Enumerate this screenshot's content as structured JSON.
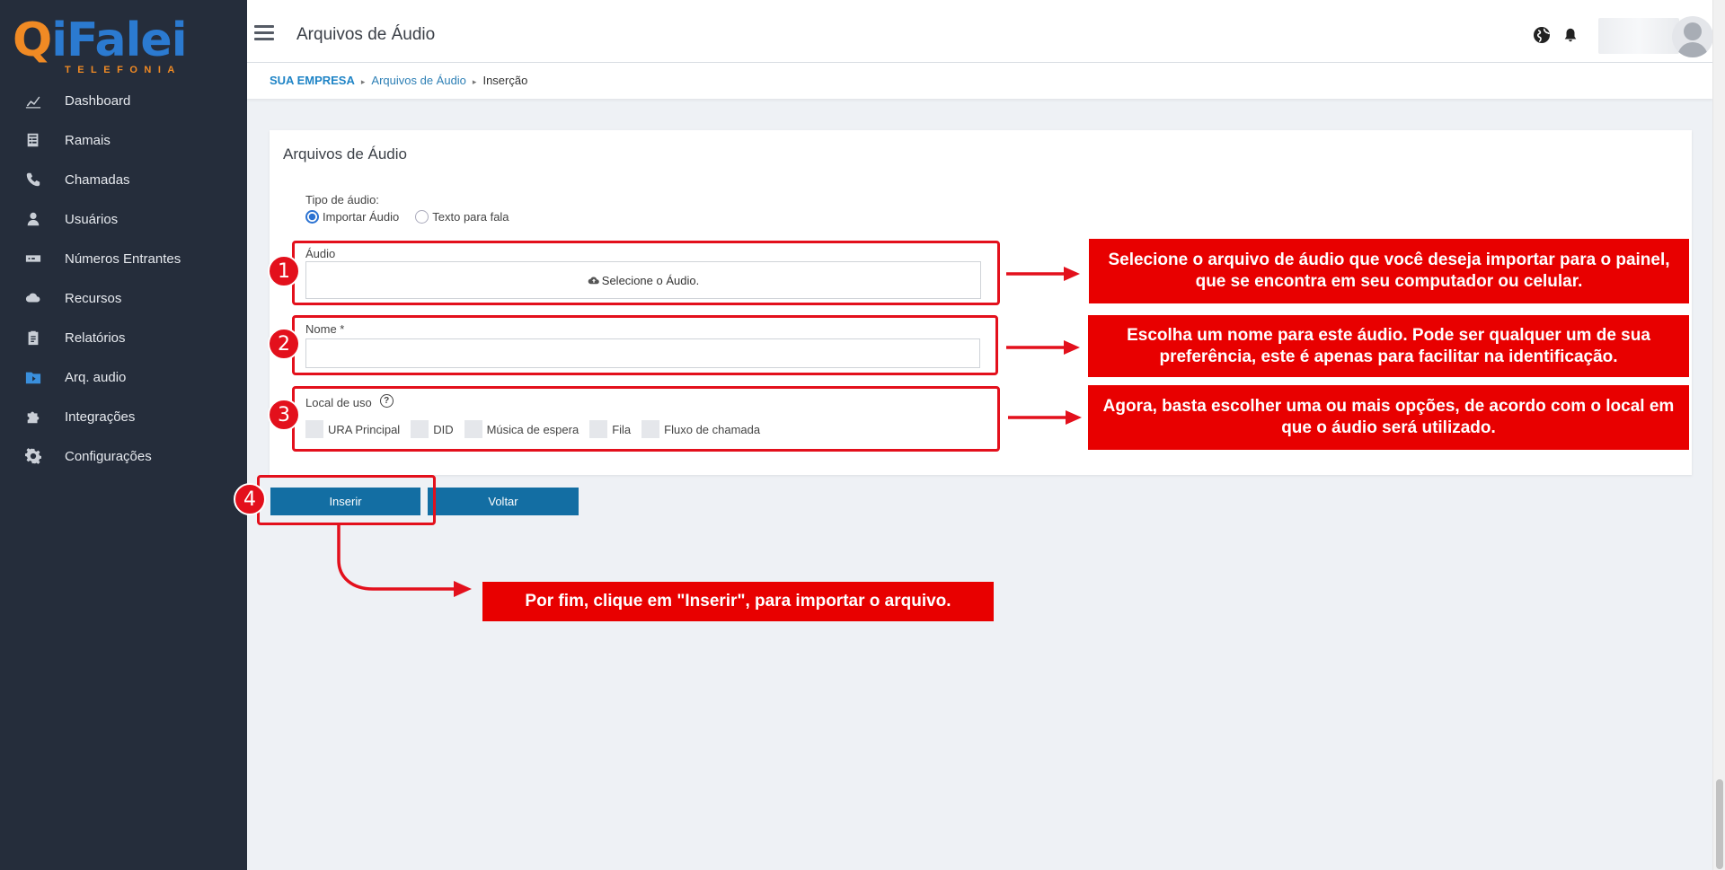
{
  "brand": {
    "logo_main": "iFalei",
    "logo_sub": "TELEFONIA",
    "orange": "#f08a24",
    "blue": "#2b7ad0"
  },
  "sidebar": {
    "items": [
      {
        "label": "Dashboard",
        "icon": "chart-icon"
      },
      {
        "label": "Ramais",
        "icon": "phonebook-icon"
      },
      {
        "label": "Chamadas",
        "icon": "phone-icon"
      },
      {
        "label": "Usuários",
        "icon": "user-icon"
      },
      {
        "label": "Números Entrantes",
        "icon": "did-icon"
      },
      {
        "label": "Recursos",
        "icon": "cloud-icon"
      },
      {
        "label": "Relatórios",
        "icon": "clipboard-icon"
      },
      {
        "label": "Arq. audio",
        "icon": "audio-folder-icon"
      },
      {
        "label": "Integrações",
        "icon": "puzzle-icon"
      },
      {
        "label": "Configurações",
        "icon": "gear-icon"
      }
    ]
  },
  "header": {
    "title": "Arquivos de Áudio"
  },
  "breadcrumb": {
    "company": "SUA EMPRESA",
    "section": "Arquivos de Áudio",
    "current": "Inserção"
  },
  "form": {
    "card_title": "Arquivos de Áudio",
    "tipo_label": "Tipo de áudio:",
    "radio_import": "Importar Áudio",
    "radio_tts": "Texto para fala",
    "selected_type": "Importar Áudio",
    "audio_label": "Áudio",
    "upload_text": "Selecione o Áudio.",
    "name_label": "Nome *",
    "name_value": "",
    "local_label": "Local de uso",
    "local_options": [
      "URA Principal",
      "DID",
      "Música de espera",
      "Fila",
      "Fluxo de chamada"
    ]
  },
  "buttons": {
    "insert": "Inserir",
    "back": "Voltar"
  },
  "annotations": {
    "badges": [
      "1",
      "2",
      "3",
      "4"
    ],
    "callout1": "Selecione o arquivo de áudio que você deseja importar para o painel, que se encontra em seu computador ou celular.",
    "callout2": "Escolha um nome para este áudio. Pode ser qualquer um de sua preferência, este é apenas para facilitar na identificação.",
    "callout3": "Agora, basta escolher uma ou mais opções, de acordo com o local em que o áudio será utilizado.",
    "callout4": "Por fim, clique em \"Inserir\", para importar o arquivo.",
    "color": "#e3101c"
  }
}
